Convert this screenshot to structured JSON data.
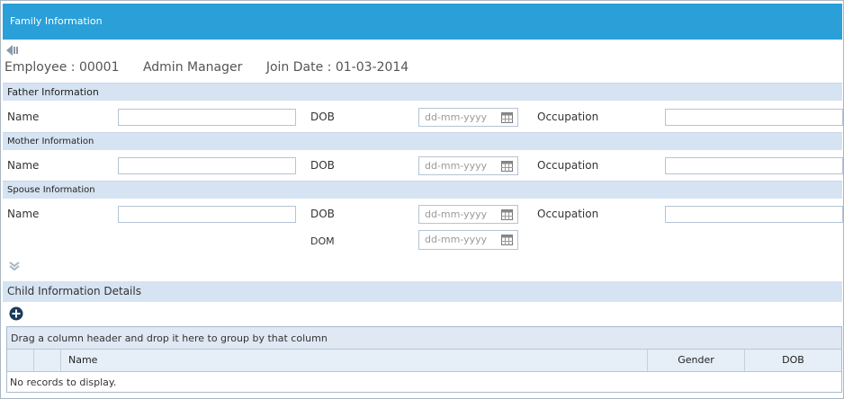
{
  "window": {
    "title": "Family Information"
  },
  "employee": {
    "id_text": "Employee : 00001",
    "role": "Admin Manager",
    "join_date_text": "Join Date : 01-03-2014"
  },
  "icons": {
    "back": "back-arrow-icon",
    "expand": "expand-chevron-icon",
    "add": "add-plus-icon",
    "calendar": "calendar-icon"
  },
  "sections": {
    "father": {
      "title": "Father Information",
      "name_label": "Name",
      "name_value": "",
      "dob_label": "DOB",
      "dob_placeholder": "dd-mm-yyyy",
      "occupation_label": "Occupation",
      "occupation_value": ""
    },
    "mother": {
      "title": "Mother Information",
      "name_label": "Name",
      "name_value": "",
      "dob_label": "DOB",
      "dob_placeholder": "dd-mm-yyyy",
      "occupation_label": "Occupation",
      "occupation_value": ""
    },
    "spouse": {
      "title": "Spouse Information",
      "name_label": "Name",
      "name_value": "",
      "dob_label": "DOB",
      "dob_placeholder": "dd-mm-yyyy",
      "occupation_label": "Occupation",
      "occupation_value": "",
      "dom_label": "DOM",
      "dom_placeholder": "dd-mm-yyyy"
    }
  },
  "child": {
    "title": "Child Information Details",
    "group_panel_text": "Drag a column header and drop it here to group by that column",
    "columns": [
      "Name",
      "Gender",
      "DOB"
    ],
    "empty_text": "No records to display."
  },
  "colors": {
    "titlebar": "#2a9fd8",
    "section_bar": "#d6e3f2"
  }
}
